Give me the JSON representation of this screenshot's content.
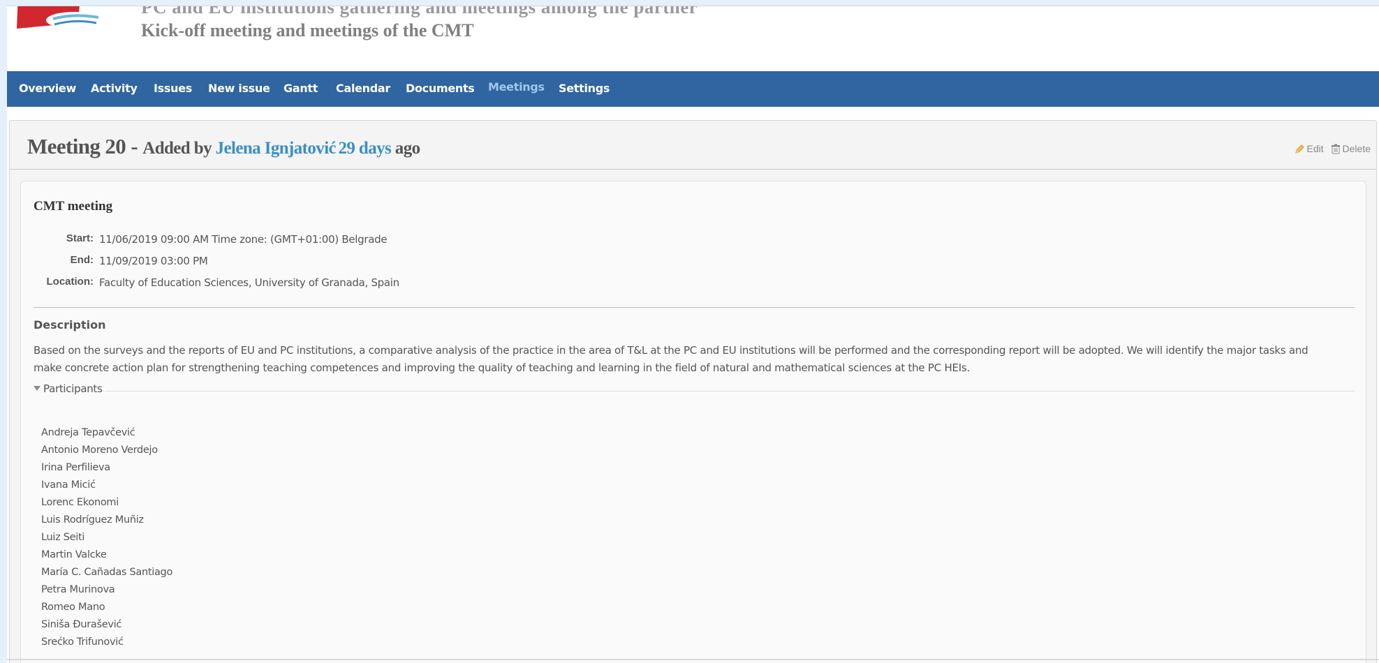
{
  "header": {
    "cutline": "PC and EU institutions gathering and meetings among the partner",
    "project_title": "Kick-off meeting and meetings of the CMT"
  },
  "menu": {
    "items": [
      {
        "label": "Overview"
      },
      {
        "label": "Activity"
      },
      {
        "label": "Issues"
      },
      {
        "label": "New issue"
      },
      {
        "label": "Gantt"
      },
      {
        "label": "Calendar"
      },
      {
        "label": "Documents"
      },
      {
        "label": "Meetings",
        "selected": true
      },
      {
        "label": "Settings"
      }
    ]
  },
  "meeting": {
    "number": "Meeting 20",
    "dash": " - ",
    "added_by": "Added by ",
    "author": "Jelena Ignjatović",
    "age": "29 days",
    "ago": " ago",
    "actions": {
      "edit": "Edit",
      "delete": "Delete"
    },
    "subject": "CMT meeting",
    "attributes": {
      "start_label": "Start:",
      "start_value": "11/06/2019 09:00 AM   Time zone: (GMT+01:00) Belgrade",
      "end_label": "End:",
      "end_value": "11/09/2019 03:00 PM",
      "location_label": "Location:",
      "location_value": "Faculty of Education Sciences, University of Granada, Spain"
    },
    "description_heading": "Description",
    "description": "Based on the surveys and the reports of EU and PC institutions, a comparative analysis of the practice in the area of T&L at the PC and EU institutions will be performed and the corresponding report will be adopted. We will identify the major tasks and make concrete action plan for strengthening teaching competences and improving the quality of teaching and learning in the field of natural and mathematical sciences at the PC HEIs.",
    "participants_label": "Participants",
    "participants": [
      "Andreja Tepavčević",
      "Antonio Moreno Verdejo",
      "Irina Perfilieva",
      "Ivana Micić",
      "Lorenc Ekonomi",
      "Luis Rodríguez Muñiz",
      "Luiz Seiti",
      "Martin Valcke",
      "María C. Cañadas Santiago",
      "Petra Murinova",
      "Romeo Mano",
      "Siniša Đurašević",
      "Srećko Trifunović"
    ]
  },
  "colors": {
    "menu_bg": "#2f65a0",
    "menu_selected": "#9fc7ea",
    "link": "#3a8fc5",
    "page_bg": "#e4f1fb"
  }
}
